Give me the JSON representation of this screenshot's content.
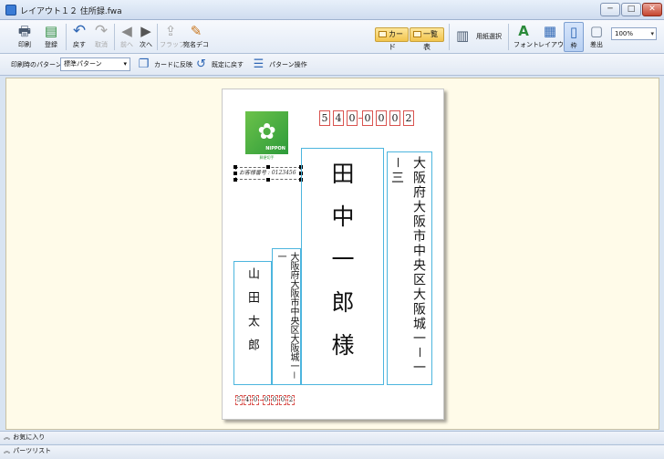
{
  "window": {
    "title": "レイアウト１２ 住所録.fwa",
    "minimize": "─",
    "maximize": "□",
    "close": "✕"
  },
  "toolbar": {
    "print": "印刷",
    "register": "登録",
    "undo": "戻す",
    "redo": "取消",
    "prev": "前へ",
    "next": "次へ",
    "flap": "フラップ",
    "address_deco": "宛名デコ",
    "card_tab": "カード",
    "list_tab": "一覧表",
    "paper_select": "用紙選択",
    "font": "フォント",
    "layout": "レイアウト",
    "frame": "枠",
    "sender": "差出",
    "zoom_value": "100%"
  },
  "pattern_bar": {
    "label": "印刷時のパターン",
    "pattern_value": "標準パターン",
    "apply_to_card": "カードに反映",
    "revert": "既定に戻す",
    "pattern_ops": "パターン操作"
  },
  "postcard": {
    "recipient_zip": [
      "5",
      "4",
      "0",
      "0",
      "0",
      "0",
      "2"
    ],
    "sender_zip": [
      "5",
      "4",
      "0",
      "0",
      "0",
      "0",
      "2"
    ],
    "customer_code": "お客様番号 : 0123456",
    "stamp_brand": "NIPPON",
    "stamp_caption": "郵便切手",
    "recipient_name": "田中一郎様",
    "recipient_address": "大阪府大阪市中央区大阪城一－一－三",
    "sender_name": "山田太郎",
    "sender_address": "大阪府大阪市中央区大阪城一－一"
  },
  "panels": {
    "favorites": "お気に入り",
    "parts_list": "パーツリスト"
  },
  "colors": {
    "workspace": "#fffbe9",
    "frame_blue": "#4cb5de",
    "zip_red": "#d9534f",
    "tab_yellow": "#f2c44d"
  }
}
